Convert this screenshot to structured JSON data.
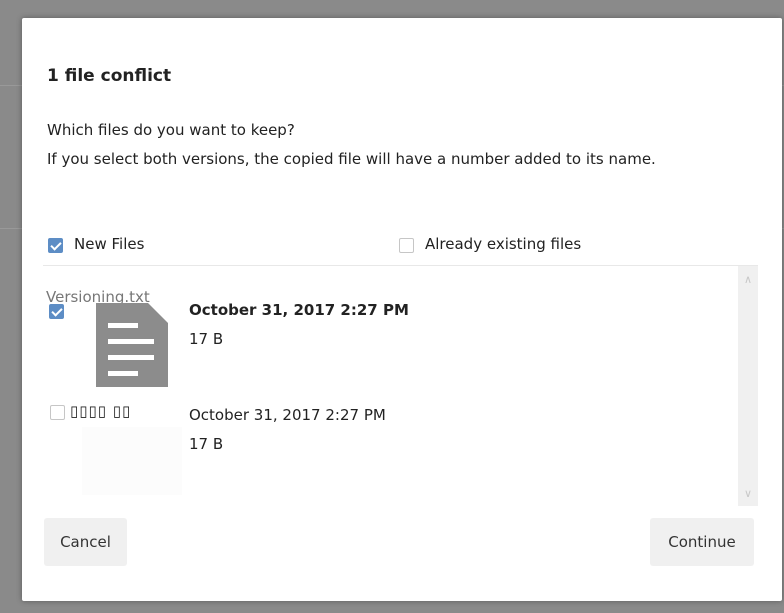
{
  "dialog": {
    "title": "1 file conflict",
    "question": "Which files do you want to keep?",
    "note": "If you select both versions, the copied file will have a number added to its name."
  },
  "columns": {
    "new_files_label": "New Files",
    "new_files_checked": true,
    "existing_files_label": "Already existing files",
    "existing_files_checked": false
  },
  "conflict": {
    "filename": "Versioning.txt",
    "new_version": {
      "checked": true,
      "date": "October 31, 2017 2:27 PM",
      "size": "17 B"
    },
    "existing_version": {
      "checked": false,
      "name_placeholder": "▯▯▯▯ ▯▯",
      "date": "October 31, 2017 2:27 PM",
      "size": "17 B"
    }
  },
  "buttons": {
    "cancel": "Cancel",
    "continue": "Continue"
  },
  "colors": {
    "accent": "#5d8dc5",
    "file_icon": "#8c8c8c",
    "button_bg": "#f0f0f0",
    "overlay": "#8a8a8a"
  }
}
